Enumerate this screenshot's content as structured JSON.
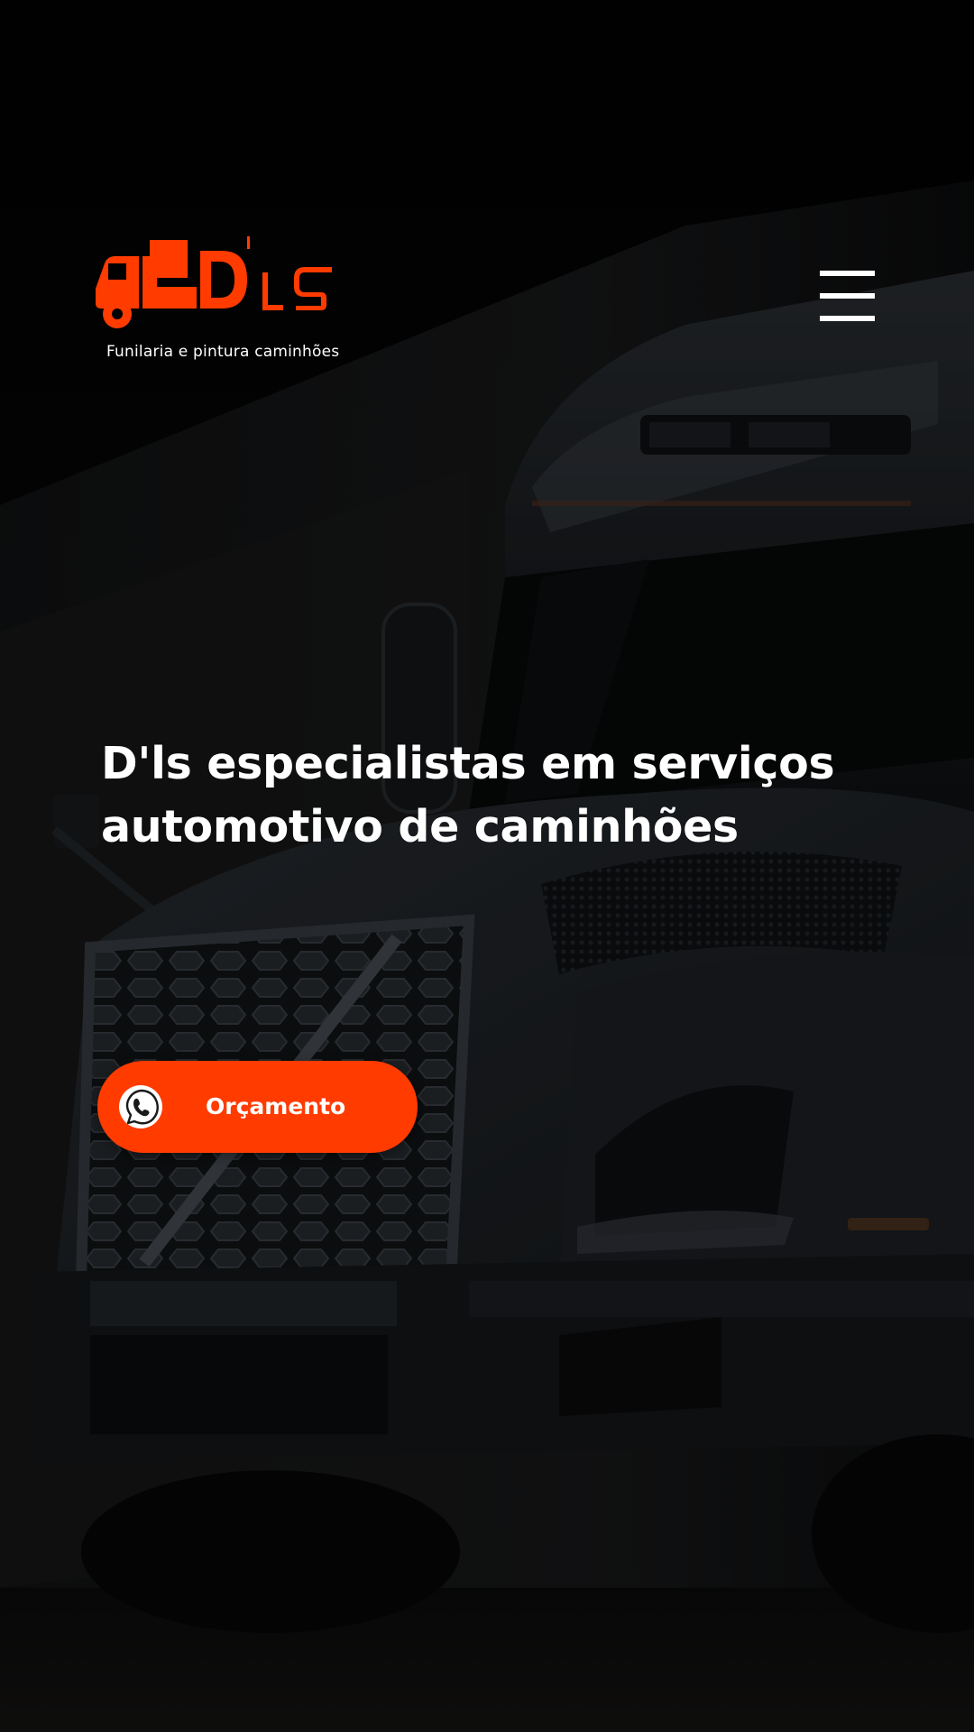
{
  "brand": {
    "logo_text": "D'ls",
    "tagline": "Funilaria e pintura caminhões",
    "accent_color": "#ff3b00"
  },
  "header": {
    "menu_icon": "hamburger-menu-icon"
  },
  "hero": {
    "headline_line1": "D'ls especialistas em serviços",
    "headline_line2": "automotivo de caminhões",
    "background_image": "truck-front-photo"
  },
  "cta": {
    "label": "Orçamento",
    "icon": "whatsapp-icon",
    "color": "#ff3b00"
  }
}
